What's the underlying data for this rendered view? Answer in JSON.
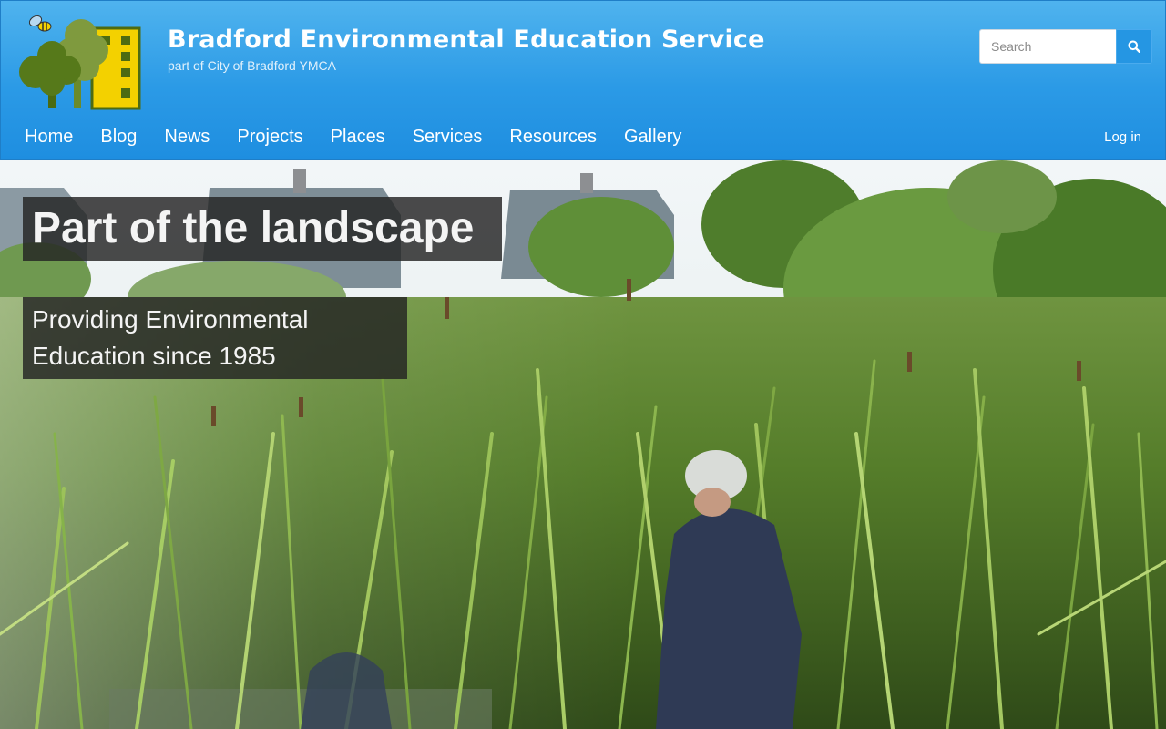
{
  "header": {
    "title": "Bradford Environmental Education Service",
    "subtitle": "part of City of Bradford YMCA",
    "logo_icon": "trees-building-bee-logo",
    "search": {
      "placeholder": "Search",
      "icon": "search-icon"
    },
    "nav": [
      {
        "label": "Home"
      },
      {
        "label": "Blog"
      },
      {
        "label": "News"
      },
      {
        "label": "Projects"
      },
      {
        "label": "Places"
      },
      {
        "label": "Services"
      },
      {
        "label": "Resources"
      },
      {
        "label": "Gallery"
      }
    ],
    "login_label": "Log in"
  },
  "hero": {
    "title": "Part of the landscape",
    "tagline_line1": "Providing Environmental",
    "tagline_line2": "Education since 1985"
  },
  "colors": {
    "header_top": "#4fb3ee",
    "header_bottom": "#1e8ee0",
    "logo_yellow": "#f3d100",
    "logo_green": "#5b7a1e"
  }
}
